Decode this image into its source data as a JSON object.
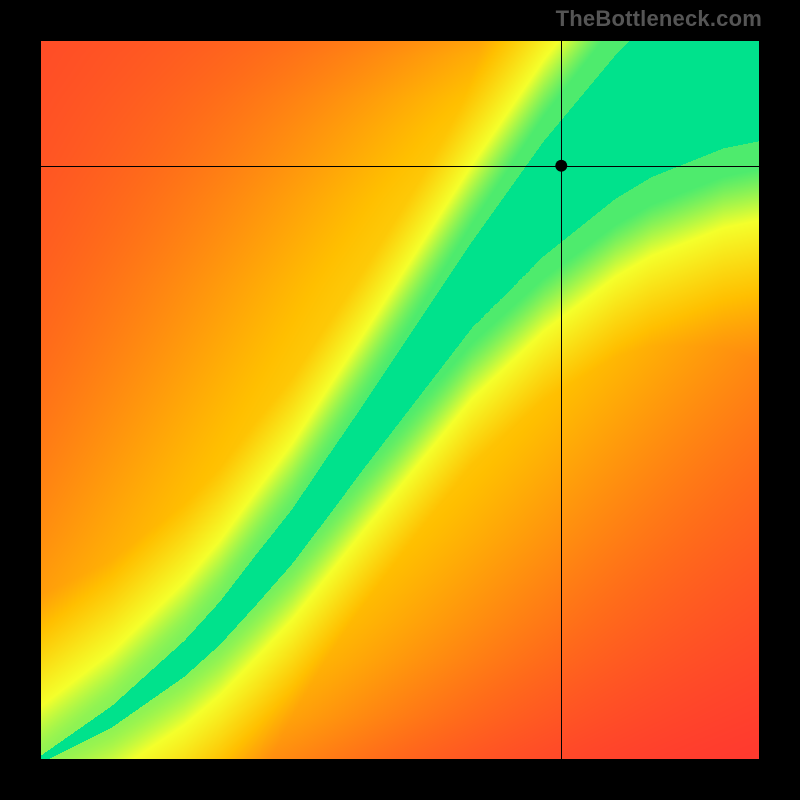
{
  "watermark": "TheBottleneck.com",
  "chart_data": {
    "type": "heatmap",
    "title": "",
    "xlabel": "",
    "ylabel": "",
    "x_range": [
      0,
      1
    ],
    "y_range": [
      0,
      1
    ],
    "ridge": [
      {
        "x": 0.0,
        "y": 0.0,
        "w": 0.005
      },
      {
        "x": 0.05,
        "y": 0.03,
        "w": 0.01
      },
      {
        "x": 0.1,
        "y": 0.06,
        "w": 0.015
      },
      {
        "x": 0.15,
        "y": 0.1,
        "w": 0.02
      },
      {
        "x": 0.2,
        "y": 0.14,
        "w": 0.025
      },
      {
        "x": 0.25,
        "y": 0.19,
        "w": 0.03
      },
      {
        "x": 0.3,
        "y": 0.25,
        "w": 0.035
      },
      {
        "x": 0.35,
        "y": 0.31,
        "w": 0.038
      },
      {
        "x": 0.4,
        "y": 0.38,
        "w": 0.042
      },
      {
        "x": 0.45,
        "y": 0.45,
        "w": 0.045
      },
      {
        "x": 0.5,
        "y": 0.52,
        "w": 0.05
      },
      {
        "x": 0.55,
        "y": 0.59,
        "w": 0.055
      },
      {
        "x": 0.6,
        "y": 0.66,
        "w": 0.06
      },
      {
        "x": 0.65,
        "y": 0.72,
        "w": 0.07
      },
      {
        "x": 0.7,
        "y": 0.78,
        "w": 0.08
      },
      {
        "x": 0.75,
        "y": 0.83,
        "w": 0.09
      },
      {
        "x": 0.8,
        "y": 0.88,
        "w": 0.1
      },
      {
        "x": 0.85,
        "y": 0.92,
        "w": 0.11
      },
      {
        "x": 0.9,
        "y": 0.95,
        "w": 0.12
      },
      {
        "x": 0.95,
        "y": 0.98,
        "w": 0.13
      },
      {
        "x": 1.0,
        "y": 1.0,
        "w": 0.14
      }
    ],
    "crosshair": {
      "x": 0.725,
      "y": 0.825
    },
    "marker": {
      "x": 0.725,
      "y": 0.825,
      "radius_px": 6
    },
    "color_stops": [
      {
        "t": 0.0,
        "hex": "#ff1a3c"
      },
      {
        "t": 0.25,
        "hex": "#ff6b1a"
      },
      {
        "t": 0.5,
        "hex": "#ffbf00"
      },
      {
        "t": 0.75,
        "hex": "#f4ff2b"
      },
      {
        "t": 1.0,
        "hex": "#00e28c"
      }
    ]
  }
}
